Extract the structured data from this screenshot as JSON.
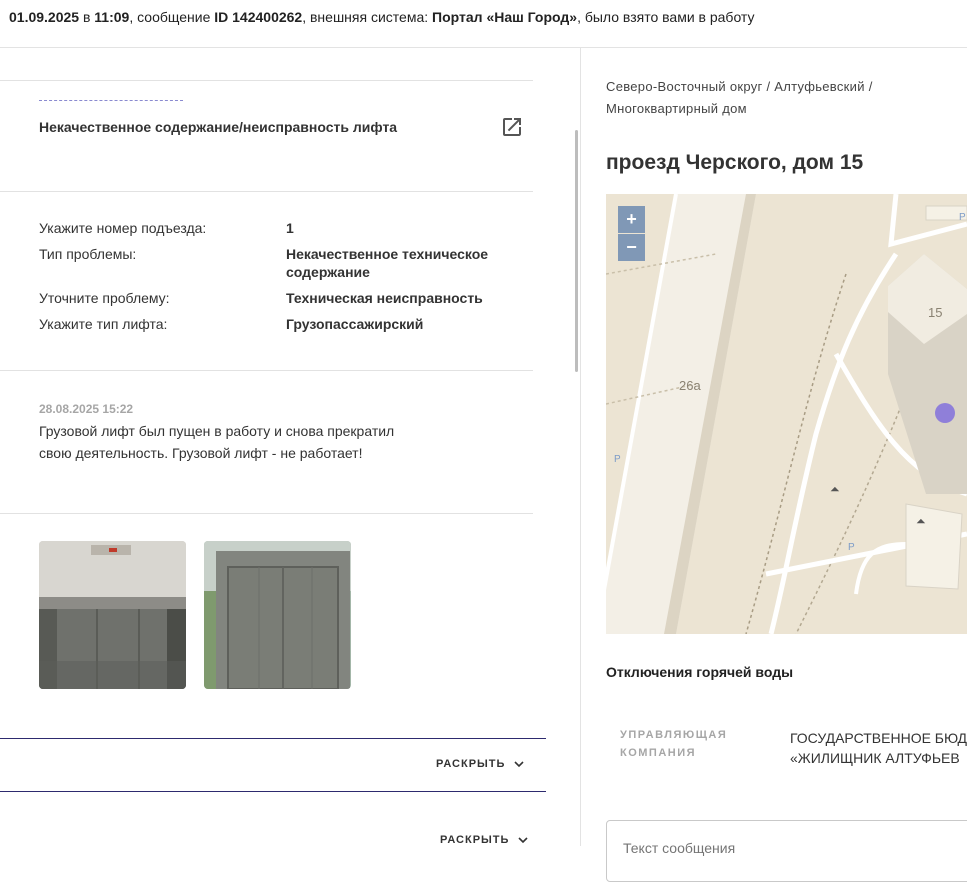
{
  "header": {
    "date": "01.09.2025",
    "in": "в",
    "time": "11:09",
    "message_word": ", сообщение",
    "message_id": "ID 142400262",
    "system_word": ", внешняя система:",
    "system_name": "Портал «Наш Город»",
    "taken_text": ", было взято вами в работу"
  },
  "issue": {
    "category": "Некачественное содержание/неисправность лифта",
    "attributes": [
      {
        "key": "Укажите номер подъезда:",
        "value": "1"
      },
      {
        "key": "Тип проблемы:",
        "value": "Некачественное техническое содержание"
      },
      {
        "key": "Уточните проблему:",
        "value": "Техническая неисправность"
      },
      {
        "key": "Укажите тип лифта:",
        "value": "Грузопассажирский"
      }
    ]
  },
  "comment": {
    "date": "28.08.2025 15:22",
    "text": "Грузовой лифт был пущен в работу и снова прекратил свою деятельность. Грузовой лифт - не работает!"
  },
  "expand": {
    "label_1": "РАСКРЫТЬ",
    "label_2": "РАСКРЫТЬ"
  },
  "location": {
    "breadcrumb": "Северо-Восточный округ / Алтуфьевский / Многоквартирный дом",
    "address": "проезд Черского, дом 15"
  },
  "map": {
    "zoom_in": "+",
    "zoom_out": "−",
    "label_26a": "26а",
    "label_15": "15",
    "marker_color": "#8f7fd9"
  },
  "hot_water": {
    "title": "Отключения горячей воды"
  },
  "management": {
    "label": "УПРАВЛЯЮЩАЯ КОМПАНИЯ",
    "line1": "ГОСУДАРСТВЕННОЕ БЮДЖ",
    "line2": "«ЖИЛИЩНИК АЛТУФЬЕВ"
  },
  "comment_input": {
    "placeholder": "Текст сообщения"
  },
  "colors": {
    "accent_line": "#2d2a6e",
    "muted_text": "#a6a6a6"
  }
}
